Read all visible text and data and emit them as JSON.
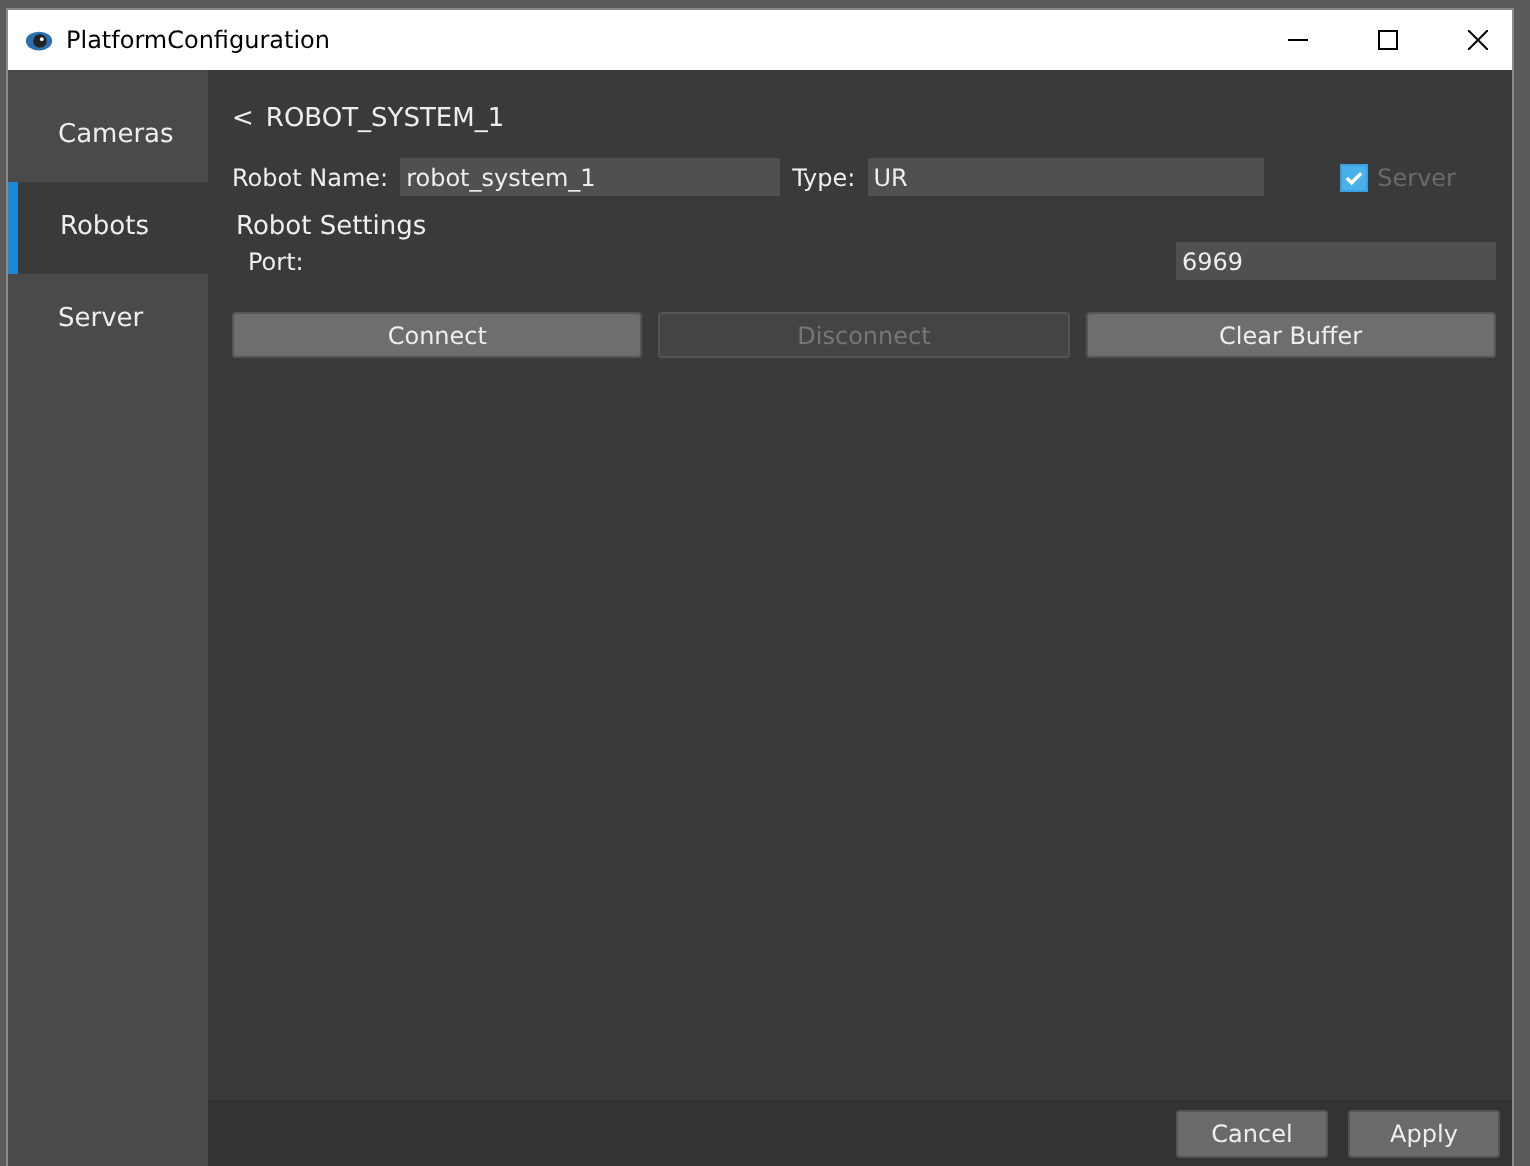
{
  "window": {
    "title": "PlatformConfiguration"
  },
  "sidebar": {
    "items": [
      {
        "label": "Cameras",
        "selected": false
      },
      {
        "label": "Robots",
        "selected": true
      },
      {
        "label": "Server",
        "selected": false
      }
    ]
  },
  "header": {
    "back": "<",
    "title": "ROBOT_SYSTEM_1"
  },
  "robot_name": {
    "label": "Robot Name:",
    "value": "robot_system_1"
  },
  "type": {
    "label": "Type:",
    "value": "UR"
  },
  "server_checkbox": {
    "label": "Server",
    "checked": true,
    "disabled": true
  },
  "robot_settings": {
    "title": "Robot Settings",
    "port_label": "Port:",
    "port_value": "6969"
  },
  "actions": [
    {
      "label": "Connect",
      "disabled": false
    },
    {
      "label": "Disconnect",
      "disabled": true
    },
    {
      "label": "Clear Buffer",
      "disabled": false
    }
  ],
  "footer_buttons": [
    "Cancel",
    "Apply"
  ]
}
